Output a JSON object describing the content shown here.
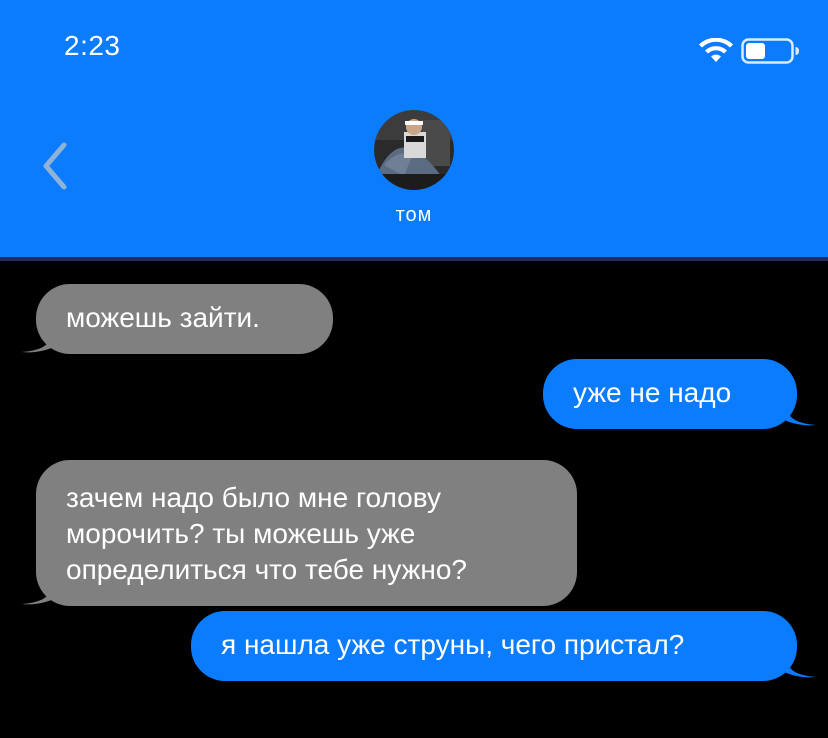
{
  "status_bar": {
    "time": "2:23",
    "icons": [
      "wifi-icon",
      "battery-icon"
    ]
  },
  "header": {
    "back_icon": "chevron-left-icon",
    "contact_name": "том",
    "accent_color": "#0a7cfd"
  },
  "messages": [
    {
      "direction": "incoming",
      "lines": [
        "можешь зайти."
      ]
    },
    {
      "direction": "outgoing",
      "lines": [
        "уже не надо"
      ]
    },
    {
      "direction": "incoming",
      "lines": [
        "зачем надо было мне голову",
        "морочить? ты можешь уже",
        "определиться что тебе нужно?"
      ]
    },
    {
      "direction": "outgoing",
      "lines": [
        "я нашла уже струны, чего пристал?"
      ]
    }
  ],
  "colors": {
    "incoming_bubble": "#808080",
    "outgoing_bubble": "#0a7cfd",
    "background": "#000000"
  }
}
